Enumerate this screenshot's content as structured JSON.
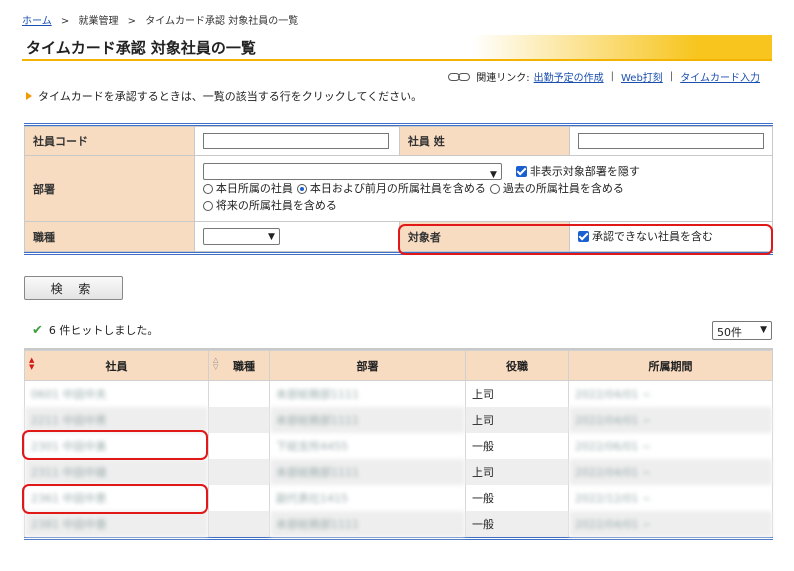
{
  "breadcrumb": {
    "home": "ホーム",
    "sep": ">",
    "section": "就業管理",
    "current": "タイムカード承認 対象社員の一覧"
  },
  "title": "タイムカード承認 対象社員の一覧",
  "related": {
    "label": "関連リンク:",
    "links": [
      "出勤予定の作成",
      "Web打刻",
      "タイムカード入力"
    ]
  },
  "instruction": "タイムカードを承認するときは、一覧の該当する行をクリックしてください。",
  "form": {
    "employee_code_label": "社員コード",
    "employee_surname_label": "社員 姓",
    "department_label": "部署",
    "hide_departments_label": "非表示対象部署を隠す",
    "radio_options": [
      "本日所属の社員",
      "本日および前月の所属社員を含める",
      "過去の所属社員を含める",
      "将来の所属社員を含める"
    ],
    "job_type_label": "職種",
    "target_label": "対象者",
    "include_unapprovable_label": "承認できない社員を含む"
  },
  "search_button": "検 索",
  "hits_text": "6 件ヒットしました。",
  "per_page": "50件",
  "colors": {
    "header_bg": "#f8dcc2",
    "accent_blue": "#3c6fc5",
    "title_yellow": "#f7c51e",
    "highlight_red": "#e01818"
  },
  "table": {
    "headers": [
      "社員",
      "職種",
      "部署",
      "役職",
      "所属期間"
    ],
    "rows": [
      {
        "employee": "0601 中田中夫",
        "job": "",
        "dept": "本部総務部1111",
        "role": "上司",
        "period": "2022/04/01 ~"
      },
      {
        "employee": "2211 中田中男",
        "job": "",
        "dept": "本部総務部1111",
        "role": "上司",
        "period": "2022/04/01 ~"
      },
      {
        "employee": "2301 中田中美",
        "job": "",
        "dept": "下総支所4455",
        "role": "一般",
        "period": "2022/06/01 ~"
      },
      {
        "employee": "2311 中田中雄",
        "job": "",
        "dept": "本部総務部1111",
        "role": "上司",
        "period": "2022/04/01 ~"
      },
      {
        "employee": "2361 中田中恵",
        "job": "",
        "dept": "副代表社1415",
        "role": "一般",
        "period": "2022/12/01 ~"
      },
      {
        "employee": "2381 中田中香",
        "job": "",
        "dept": "本部総務部1111",
        "role": "一般",
        "period": "2022/04/01 ~"
      }
    ]
  }
}
